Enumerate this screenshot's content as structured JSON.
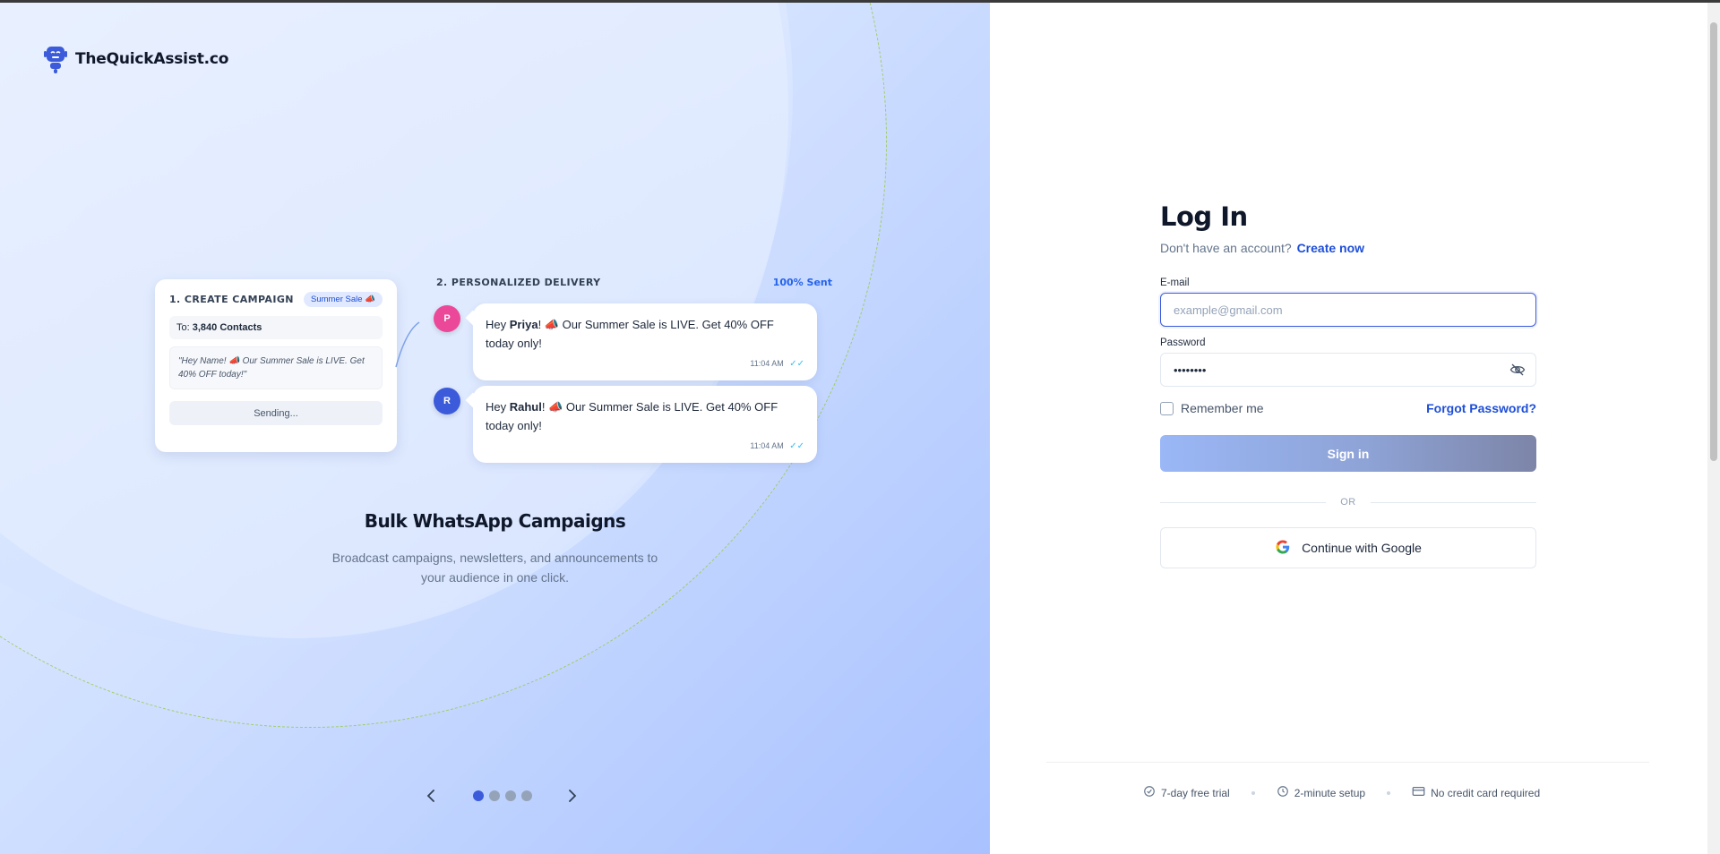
{
  "brand": {
    "name": "TheQuickAssist.co"
  },
  "campaign": {
    "title": "1. CREATE CAMPAIGN",
    "badge": "Summer Sale 📣",
    "to_prefix": "To:",
    "to_count": "3,840 Contacts",
    "template": "\"Hey Name! 📣 Our Summer Sale is LIVE. Get 40% OFF today!\"",
    "button": "Sending..."
  },
  "delivery": {
    "title": "2. PERSONALIZED DELIVERY",
    "status": "100% Sent",
    "messages": [
      {
        "initial": "P",
        "avatar_color": "#ec4899",
        "greeting": "Hey",
        "name": "Priya",
        "text": "! 📣 Our Summer Sale is LIVE. Get 40% OFF today only!",
        "time": "11:04 AM",
        "ticks": "✓✓"
      },
      {
        "initial": "R",
        "avatar_color": "#3b5bdb",
        "greeting": "Hey",
        "name": "Rahul",
        "text": "! 📣 Our Summer Sale is LIVE. Get 40% OFF today only!",
        "time": "11:04 AM",
        "ticks": "✓✓"
      }
    ]
  },
  "feature": {
    "title": "Bulk WhatsApp Campaigns",
    "description": "Broadcast campaigns, newsletters, and announcements to your audience in one click."
  },
  "carousel": {
    "slides": 4,
    "active_index": 0,
    "prev_icon": "chevron-left-icon",
    "next_icon": "chevron-right-icon"
  },
  "login": {
    "title": "Log In",
    "no_account": "Don't have an account?",
    "create_link": "Create now",
    "email_label": "E-mail",
    "email_placeholder": "example@gmail.com",
    "email_value": "",
    "password_label": "Password",
    "password_value": "••••••••",
    "remember_label": "Remember me",
    "remember_checked": false,
    "forgot_label": "Forgot Password?",
    "signin_label": "Sign in",
    "or_label": "OR",
    "google_label": "Continue with Google"
  },
  "footer": {
    "items": [
      {
        "icon": "check-circle-icon",
        "label": "7-day free trial"
      },
      {
        "icon": "clock-icon",
        "label": "2-minute setup"
      },
      {
        "icon": "credit-card-icon",
        "label": "No credit card required"
      }
    ]
  },
  "colors": {
    "accent": "#1d4ed8",
    "active_dot": "#3b5bdb",
    "focus_border": "#3b5bdb"
  }
}
